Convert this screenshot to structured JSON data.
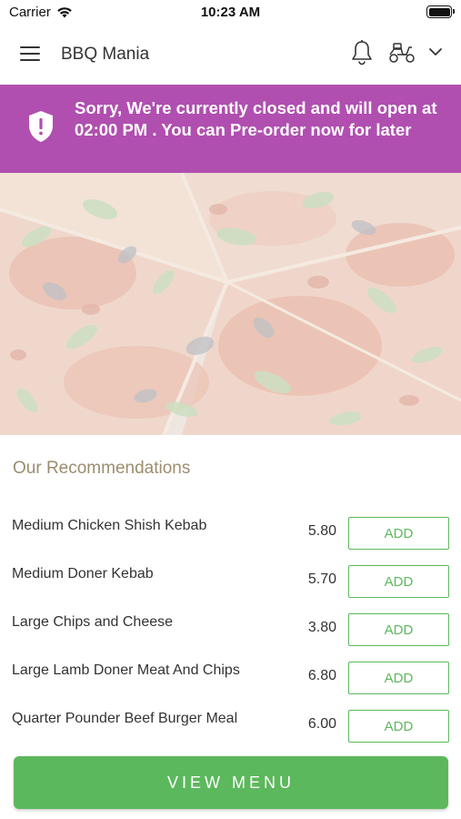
{
  "status_bar": {
    "carrier": "Carrier",
    "time": "10:23 AM",
    "icons": [
      "wifi-icon",
      "battery-icon"
    ]
  },
  "header": {
    "title": "BBQ Mania",
    "icons": [
      "hamburger-menu-icon",
      "bell-icon",
      "scooter-icon",
      "chevron-down-icon"
    ]
  },
  "banner": {
    "message": "Sorry, We're currently closed and will open at 02:00 PM . You can Pre-order now for later",
    "icon": "shield-alert-icon",
    "color": "#b04fb0"
  },
  "hero": {
    "subject": "pizza"
  },
  "recommendations": {
    "title": "Our Recommendations",
    "items": [
      {
        "name": "Medium Chicken Shish Kebab",
        "price": "5.80",
        "add_label": "ADD"
      },
      {
        "name": "Medium Doner Kebab",
        "price": "5.70",
        "add_label": "ADD"
      },
      {
        "name": "Large Chips and Cheese",
        "price": "3.80",
        "add_label": "ADD"
      },
      {
        "name": "Large Lamb Doner Meat And Chips",
        "price": "6.80",
        "add_label": "ADD"
      },
      {
        "name": "Quarter Pounder Beef Burger Meal",
        "price": "6.00",
        "add_label": "ADD"
      }
    ]
  },
  "actions": {
    "view_menu_label": "VIEW MENU"
  },
  "colors": {
    "accent_green": "#5cb85c",
    "banner_purple": "#b04fb0",
    "section_title": "#9c8d6e"
  }
}
